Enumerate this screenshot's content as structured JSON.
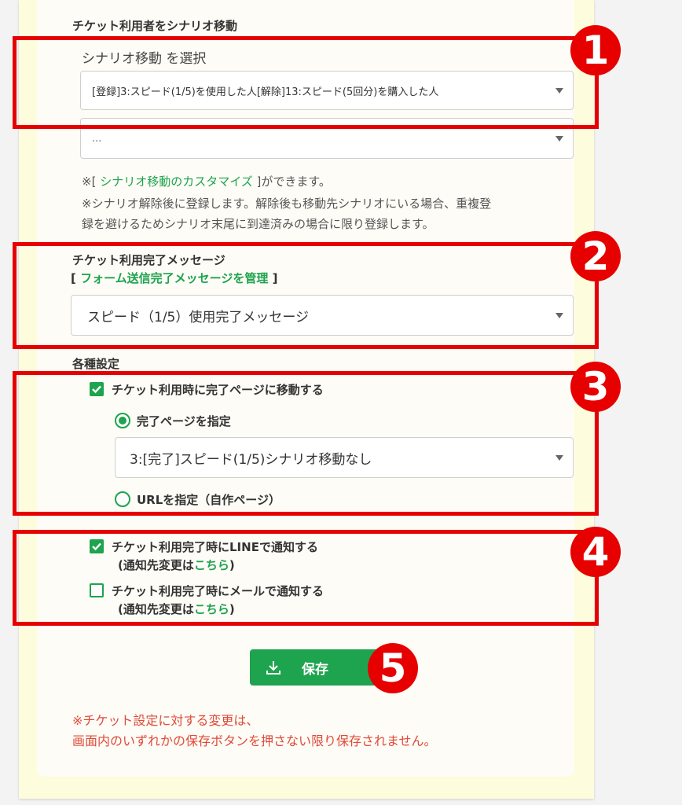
{
  "scenario": {
    "heading": "チケット利用者をシナリオ移動",
    "select_label": "シナリオ移動 を選択",
    "select_1_value": "[登録]3:スピード(1/5)を使用した人[解除]13:スピード(5回分)を購入した人",
    "select_2_value": "...",
    "customize_prefix": "※[",
    "customize_link": "シナリオ移動のカスタマイズ",
    "customize_suffix": "]ができます。",
    "note_line1": "※シナリオ解除後に登録します。解除後も移動先シナリオにいる場合、重複登",
    "note_line2": "録を避けるためシナリオ末尾に到達済みの場合に限り登録します。"
  },
  "complete_message": {
    "heading": "チケット利用完了メッセージ",
    "manage_prefix": "[",
    "manage_link": "フォーム送信完了メッセージを管理",
    "manage_suffix": "]",
    "select_value": "スピード（1/5）使用完了メッセージ"
  },
  "settings": {
    "heading": "各種設定",
    "move_to_complete_page": {
      "label": "チケット利用時に完了ページに移動する",
      "checked": true
    },
    "radio_specify_page": {
      "label": "完了ページを指定",
      "selected": true
    },
    "page_select_value": "3:[完了]スピード(1/5)シナリオ移動なし",
    "radio_specify_url": {
      "label": "URLを指定（自作ページ）",
      "selected": false
    }
  },
  "notifications": {
    "line": {
      "label": "チケット利用完了時にLINEで通知する",
      "checked": true,
      "sub_prefix": "(通知先変更は",
      "sub_link": "こちら",
      "sub_suffix": ")"
    },
    "mail": {
      "label": "チケット利用完了時にメールで通知する",
      "checked": false,
      "sub_prefix": "(通知先変更は",
      "sub_link": "こちら",
      "sub_suffix": ")"
    }
  },
  "save_button": {
    "label": "保存",
    "icon": "download-icon"
  },
  "warning": {
    "line1": "※チケット設定に対する変更は、",
    "line2": "画面内のいずれかの保存ボタンを押さない限り保存されません。"
  },
  "annotations": {
    "n1": "1",
    "n2": "2",
    "n3": "3",
    "n4": "4",
    "n5": "5"
  },
  "colors": {
    "accent_green": "#1ea34e",
    "annotation_red": "#e60000",
    "warning_text": "#e04a3a",
    "page_background": "#fdfcdc"
  }
}
